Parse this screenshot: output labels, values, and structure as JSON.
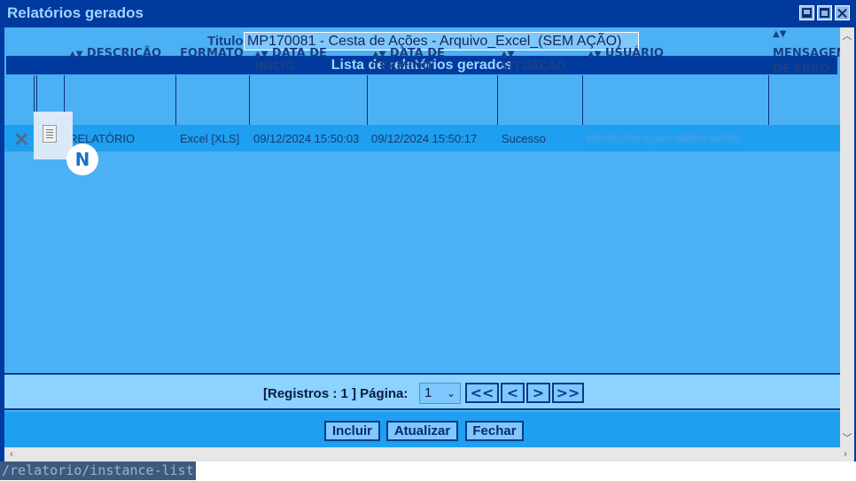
{
  "window": {
    "title": "Relatórios gerados"
  },
  "form": {
    "title_label": "Titulo",
    "title_value": "MP170081 - Cesta de Ações - Arquivo_Excel_(SEM AÇÃO)"
  },
  "list": {
    "header": "Lista de relatórios gerados",
    "columns": {
      "descricao": "DESCRIÇÃO",
      "formato": "FORMATO",
      "data_inicio": "DATA DE INÍCIO",
      "data_termino": "DATA DE TÉRMINO",
      "situacao": "SITUAÇÃO",
      "usuario": "USUÁRIO",
      "mensagem_1": "MENSAGEM",
      "mensagem_2": "DE ERRO"
    },
    "rows": [
      {
        "descricao": "RELATÓRIO",
        "formato": "Excel [XLS]",
        "data_inicio": "09/12/2024 15:50:03",
        "data_termino": "09/12/2024 15:50:17",
        "situacao": "Sucesso",
        "usuario": "ERIVELTON ELIAS ABREU MATEL",
        "mensagem": ""
      }
    ],
    "badge": "N"
  },
  "pager": {
    "registros": "[Registros : 1 ] Página:",
    "page_value": "1",
    "first": "<<",
    "prev": "<",
    "next": ">",
    "last": ">>"
  },
  "actions": {
    "incluir": "Incluir",
    "atualizar": "Atualizar",
    "fechar": "Fechar"
  },
  "statusbar": {
    "url": "/relatorio/instance-list"
  },
  "icons": {
    "delete": "close-x-icon",
    "document": "document-icon",
    "sort": "sort-arrows-icon",
    "select": "chevron-down-icon"
  },
  "colors": {
    "titlebar": "#003a9e",
    "content": "#4bb1f4",
    "row_selected": "#1e9ff0",
    "title_text": "#9fd4ff"
  }
}
